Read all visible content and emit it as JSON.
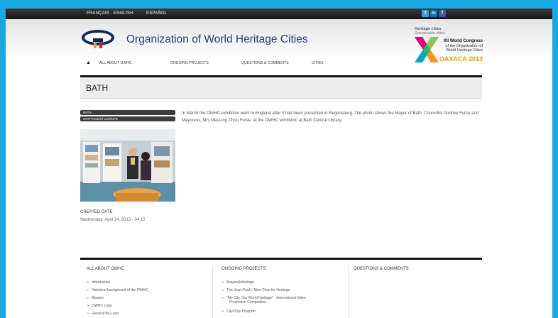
{
  "topbar": {
    "languages": [
      "FRANÇAIS",
      "ENGLISH",
      "ESPAÑOL"
    ],
    "social": [
      {
        "name": "twitter-icon",
        "glyph": "t",
        "color": "#2aa3e0"
      },
      {
        "name": "linkedin-icon",
        "glyph": "in",
        "color": "#1b6fb0"
      },
      {
        "name": "facebook-icon",
        "glyph": "f",
        "color": "#3b5998"
      }
    ]
  },
  "header": {
    "org_name": "Organization of World Heritage Cities",
    "nav": {
      "home_icon": "home-icon",
      "items": [
        "ALL ABOUT OWHC",
        "ONGOING PROJECTS",
        "QUESTIONS & COMMENTS",
        "CITIES"
      ]
    },
    "congress": {
      "line1": "Heritage cities",
      "line2": "Sustainable cities",
      "line3": "XII World Congress",
      "line4": "of the Organization of",
      "line5": "World Heritage Cities",
      "city": "OAXACA 2013"
    }
  },
  "page": {
    "title": "BATH",
    "tags": [
      "BATH",
      "NORTHWEST EUROPE"
    ],
    "description": "In March the OWHC exhibition went to England after it had been presented in Regensburg. The photo shows the Mayor of Bath, Councillor Andrew Furse and Mayoress, Mrs Mei-Ling Chou Furse, at the OWHC exhibition at Bath Central Library.",
    "created_label": "CREATED DATE",
    "created_value": "Wednesday, April 24, 2013 - 04:15"
  },
  "footer": {
    "col1": {
      "title": "ALL ABOUT OWHC",
      "links": [
        "Introduction",
        "Historical background of the OWHC",
        "Mission",
        "OWHC Logo",
        "General By-Laws"
      ]
    },
    "col2": {
      "title": "ONGOING PROJECTS",
      "links": [
        "Mayors&Heritage",
        "The Jean-Paul L'Allier Prize for Heritage",
        "\"My City, Our World Heritage\" - International Video",
        "Production Competition",
        "City2City Program"
      ]
    },
    "col3": {
      "title": "QUESTIONS & COMMENTS"
    }
  },
  "colors": {
    "background": "#19a9e2",
    "brand_navy": "#0c2a5a",
    "congress_orange": "#e79a1d"
  }
}
